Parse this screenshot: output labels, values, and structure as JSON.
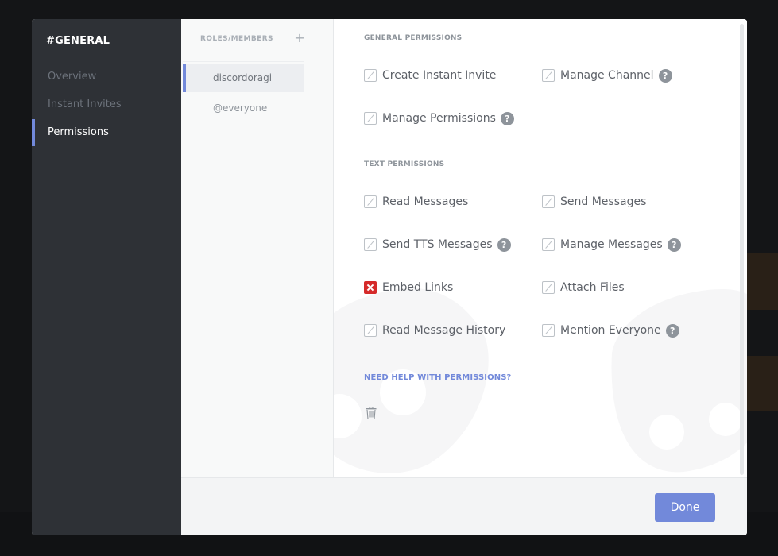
{
  "channel_title": "#GENERAL",
  "nav": {
    "items": [
      {
        "label": "Overview",
        "active": false
      },
      {
        "label": "Instant Invites",
        "active": false
      },
      {
        "label": "Permissions",
        "active": true
      }
    ]
  },
  "roles": {
    "header": "ROLES/MEMBERS",
    "add_icon": "plus-icon",
    "items": [
      {
        "label": "discordoragi",
        "active": true
      },
      {
        "label": "@everyone",
        "active": false
      }
    ]
  },
  "sections": {
    "general": {
      "title": "GENERAL PERMISSIONS",
      "permissions": [
        {
          "label": "Create Instant Invite",
          "state": "neutral",
          "help": false
        },
        {
          "label": "Manage Channel",
          "state": "neutral",
          "help": true
        },
        {
          "label": "Manage Permissions",
          "state": "neutral",
          "help": true
        }
      ]
    },
    "text": {
      "title": "TEXT PERMISSIONS",
      "permissions": [
        {
          "label": "Read Messages",
          "state": "neutral",
          "help": false
        },
        {
          "label": "Send Messages",
          "state": "neutral",
          "help": false
        },
        {
          "label": "Send TTS Messages",
          "state": "neutral",
          "help": true
        },
        {
          "label": "Manage Messages",
          "state": "neutral",
          "help": true
        },
        {
          "label": "Embed Links",
          "state": "deny",
          "help": false
        },
        {
          "label": "Attach Files",
          "state": "neutral",
          "help": false
        },
        {
          "label": "Read Message History",
          "state": "neutral",
          "help": false
        },
        {
          "label": "Mention Everyone",
          "state": "neutral",
          "help": true
        }
      ]
    }
  },
  "help_glyph": "?",
  "help_link": "NEED HELP WITH PERMISSIONS?",
  "delete_icon": "trash-icon",
  "footer": {
    "done_label": "Done"
  },
  "colors": {
    "accent": "#7289da",
    "deny": "#d52a2a",
    "sidebar": "#2e3136"
  }
}
